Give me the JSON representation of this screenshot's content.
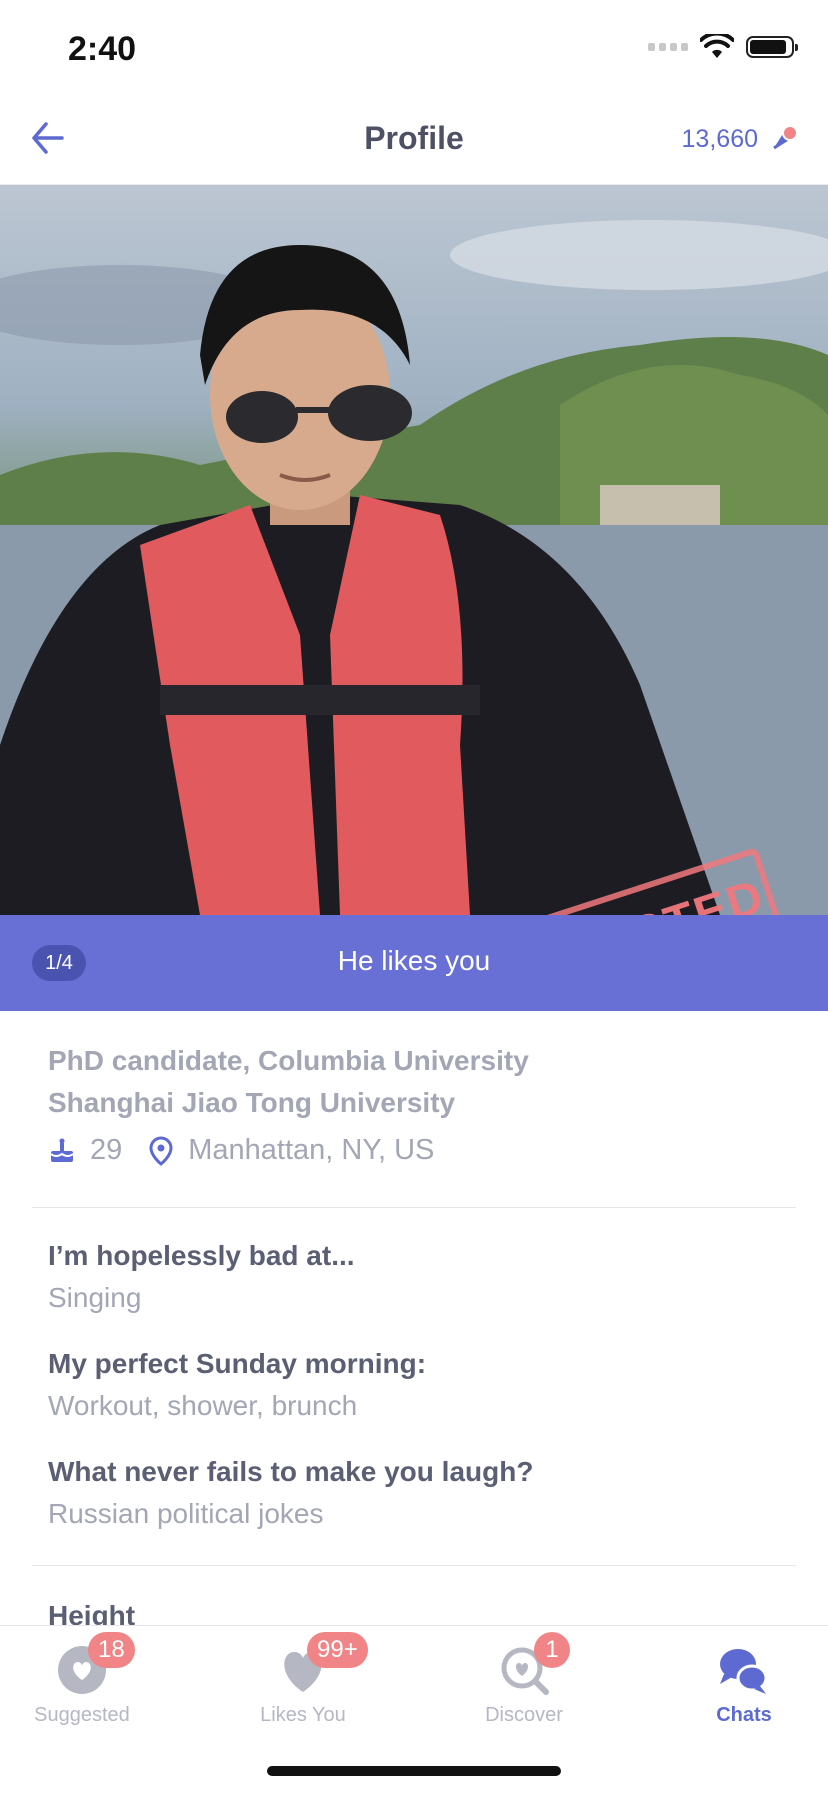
{
  "status_bar": {
    "time": "2:40"
  },
  "nav": {
    "title": "Profile",
    "coins": "13,660"
  },
  "photo": {
    "stamp": "CONNECTED",
    "counter": "1/4",
    "banner": "He likes you"
  },
  "profile": {
    "education": [
      "PhD candidate, Columbia University",
      "Shanghai Jiao Tong University"
    ],
    "age": "29",
    "location": "Manhattan, NY, US"
  },
  "prompts": [
    {
      "question": "I’m hopelessly bad at...",
      "answer": "Singing"
    },
    {
      "question": "My perfect Sunday morning:",
      "answer": "Workout, shower, brunch"
    },
    {
      "question": "What never fails to make you laugh?",
      "answer": "Russian political jokes"
    }
  ],
  "next_section": {
    "label": "Height"
  },
  "tabs": [
    {
      "label": "Suggested",
      "badge": "18",
      "icon": "heart-circle-icon",
      "active": false
    },
    {
      "label": "Likes You",
      "badge": "99+",
      "icon": "heart-icon",
      "active": false
    },
    {
      "label": "Discover",
      "badge": "1",
      "icon": "search-heart-icon",
      "active": false
    },
    {
      "label": "Chats",
      "badge": "",
      "icon": "chat-bubbles-icon",
      "active": true
    }
  ],
  "colors": {
    "accent": "#5c6ad1",
    "badge": "#f08486",
    "muted": "#a3a6b4",
    "text": "#5a5f73"
  }
}
